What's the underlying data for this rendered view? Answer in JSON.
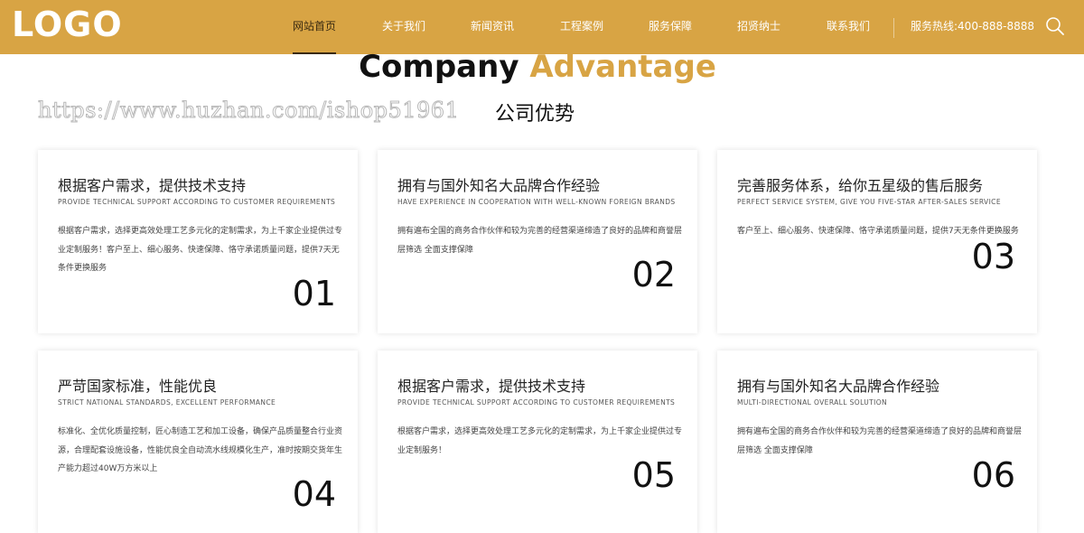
{
  "header": {
    "logo": "LOGO",
    "nav": [
      "网站首页",
      "关于我们",
      "新闻资讯",
      "工程案例",
      "服务保障",
      "招贤纳士",
      "联系我们"
    ],
    "hotline": "服务热线:400-888-8888",
    "brand_color": "#d8a444",
    "search_icon": "search-icon"
  },
  "section": {
    "title_en_1": "Company",
    "title_en_2": "Advantage",
    "watermark": "https://www.huzhan.com/ishop51961",
    "title_cn": "公司优势"
  },
  "cards": [
    {
      "title": "根据客户需求，提供技术支持",
      "subtitle": "PROVIDE TECHNICAL SUPPORT ACCORDING TO CUSTOMER REQUIREMENTS",
      "desc": "根据客户需求，选择更高效处理工艺多元化的定制需求，为上千家企业提供过专业定制服务！客户至上、细心服务、快速保障、恪守承诺质量问题，提供7天无条件更换服务",
      "num": "01"
    },
    {
      "title": "拥有与国外知名大品牌合作经验",
      "subtitle": "HAVE EXPERIENCE IN COOPERATION WITH WELL-KNOWN FOREIGN BRANDS",
      "desc": "拥有遍布全国的商务合作伙伴和较为完善的经营渠道缔造了良好的品牌和商誉层层筛选 全面支撑保障",
      "num": "02"
    },
    {
      "title": "完善服务体系，给你五星级的售后服务",
      "subtitle": "PERFECT SERVICE SYSTEM, GIVE YOU FIVE-STAR AFTER-SALES SERVICE",
      "desc": "客户至上、细心服务、快速保障、恪守承诺质量问题，提供7天无条件更换服务",
      "num": "03"
    },
    {
      "title": "严苛国家标准，性能优良",
      "subtitle": "STRICT NATIONAL STANDARDS, EXCELLENT PERFORMANCE",
      "desc": "标准化、全优化质量控制，匠心制造工艺和加工设备，确保产品质量整合行业资源，合理配套设施设备，性能优良全自动流水线规模化生产，准时按期交货年生产能力超过40W万方米以上",
      "num": "04"
    },
    {
      "title": "根据客户需求，提供技术支持",
      "subtitle": "PROVIDE TECHNICAL SUPPORT ACCORDING TO CUSTOMER REQUIREMENTS",
      "desc": "根据客户需求，选择更高效处理工艺多元化的定制需求，为上千家企业提供过专业定制服务！",
      "num": "05"
    },
    {
      "title": "拥有与国外知名大品牌合作经验",
      "subtitle": "MULTI-DIRECTIONAL OVERALL SOLUTION",
      "desc": "拥有遍布全国的商务合作伙伴和较为完善的经营渠道缔造了良好的品牌和商誉层层筛选 全面支撑保障",
      "num": "06"
    }
  ]
}
